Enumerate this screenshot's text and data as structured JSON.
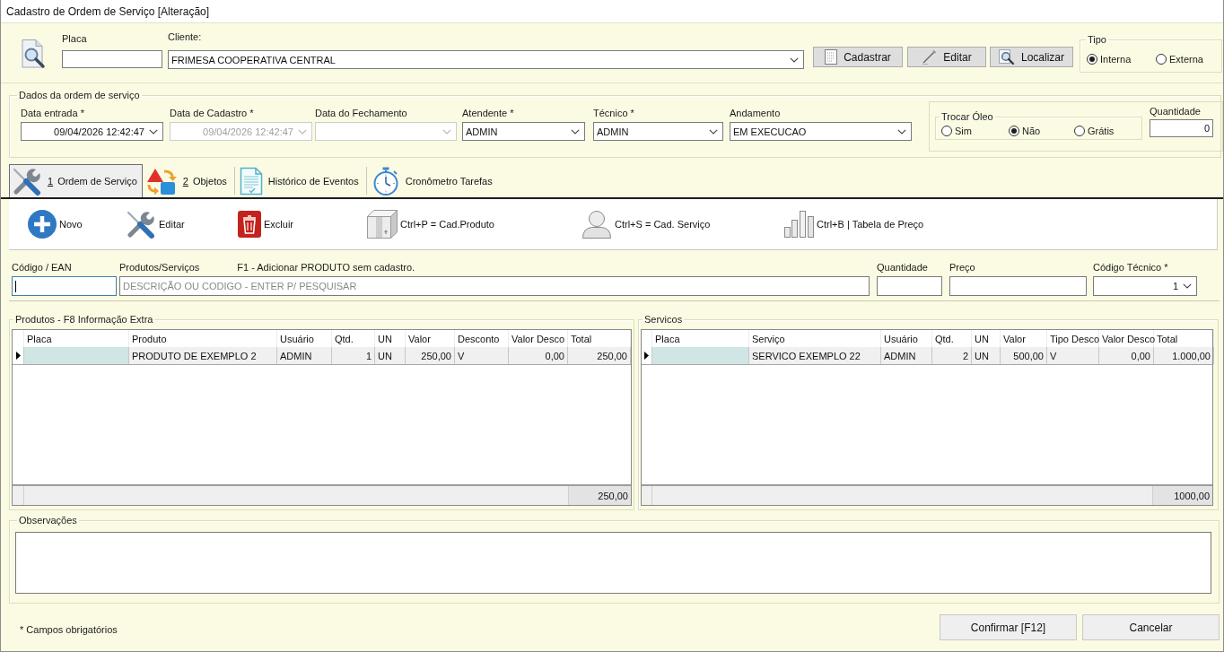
{
  "window": {
    "title": "Cadastro de Ordem de Serviço [Alteração]"
  },
  "header": {
    "placa": {
      "label": "Placa"
    },
    "cliente": {
      "label": "Cliente:",
      "value": "FRIMESA COOPERATIVA CENTRAL"
    },
    "buttons": [
      {
        "label": "Cadastrar",
        "kind": "document"
      },
      {
        "label": "Editar",
        "kind": "pencil"
      },
      {
        "label": "Localizar",
        "kind": "search"
      }
    ],
    "tipo": {
      "label": "Tipo",
      "options": [
        {
          "label": "Interna",
          "selected": true
        },
        {
          "label": "Externa",
          "selected": false
        }
      ]
    }
  },
  "dados": {
    "title": "Dados da ordem de serviço",
    "fields": [
      {
        "label": "Data entrada *",
        "kind": "date",
        "value": "09/04/2026 12:42:47",
        "disabled": false
      },
      {
        "label": "Data de Cadastro *",
        "kind": "date",
        "value": "09/04/2026 12:42:47",
        "disabled": true
      },
      {
        "label": "Data do Fechamento",
        "kind": "date",
        "disabled": true
      },
      {
        "label": "Atendente *",
        "kind": "select",
        "value": "ADMIN",
        "disabled": false
      },
      {
        "label": "Técnico *",
        "kind": "select",
        "value": "ADMIN",
        "disabled": false
      },
      {
        "label": "Andamento",
        "kind": "select",
        "value": "EM EXECUCAO",
        "disabled": false
      }
    ],
    "trocar_oleo": {
      "label": "Trocar Óleo",
      "options": [
        {
          "label": "Sim",
          "selected": false
        },
        {
          "label": "Não",
          "selected": true
        },
        {
          "label": "Grátis",
          "selected": false
        }
      ]
    },
    "quantidade": {
      "label": "Quantidade",
      "value": "0"
    }
  },
  "tabs": [
    {
      "hotkey": "1",
      "label": "Ordem de Serviço",
      "kind": "tools",
      "selected": true
    },
    {
      "hotkey": "2",
      "label": "Objetos",
      "kind": "shapes",
      "selected": false
    },
    {
      "label": "Histórico de Eventos",
      "kind": "document",
      "selected": false
    },
    {
      "label": "Cronômetro Tarefas",
      "kind": "stopwatch",
      "selected": false
    }
  ],
  "toolbar": [
    {
      "label": "Novo",
      "kind": "add"
    },
    {
      "label": "Editar",
      "kind": "tools"
    },
    {
      "label": "Excluir",
      "kind": "delete"
    },
    {
      "label": "Ctrl+P = Cad.Produto",
      "kind": "box"
    },
    {
      "label": "Ctrl+S = Cad. Serviço",
      "kind": "person"
    },
    {
      "label": "Ctrl+B | Tabela de Preço",
      "kind": "chart"
    }
  ],
  "item_entry": {
    "codigo": {
      "label": "Código / EAN",
      "focused": true
    },
    "produto": {
      "label": "Produtos/Serviços",
      "hint": "F1 - Adicionar PRODUTO sem cadastro.",
      "placeholder": "DESCRIÇÃO OU CODIGO - ENTER P/ PESQUISAR"
    },
    "quantidade": {
      "label": "Quantidade"
    },
    "preco": {
      "label": "Preço"
    },
    "codigo_tecnico": {
      "label": "Código Técnico *",
      "value": "1"
    }
  },
  "produtos": {
    "title": "Produtos - F8 Informação Extra",
    "columns": [
      {
        "label": "Placa",
        "kind": "text"
      },
      {
        "label": "Produto",
        "kind": "text"
      },
      {
        "label": "Usuário",
        "kind": "text"
      },
      {
        "label": "Qtd.",
        "kind": "number"
      },
      {
        "label": "UN",
        "kind": "text"
      },
      {
        "label": "Valor",
        "kind": "number"
      },
      {
        "label": "Desconto",
        "kind": "text"
      },
      {
        "label": "Valor Desco",
        "kind": "number"
      },
      {
        "label": "Total",
        "kind": "number"
      }
    ],
    "rows": [
      {
        "selected": true,
        "cells": [
          {
            "focused": true
          },
          {
            "text": "PRODUTO DE EXEMPLO 2",
            "focused": false
          },
          {
            "text": "ADMIN",
            "focused": false
          },
          {
            "text": "1",
            "focused": false
          },
          {
            "text": "UN",
            "focused": false
          },
          {
            "text": "250,00",
            "focused": false
          },
          {
            "text": "V",
            "focused": false
          },
          {
            "text": "0,00",
            "focused": false
          },
          {
            "text": "250,00",
            "focused": false
          }
        ]
      }
    ],
    "total": "250,00"
  },
  "servicos": {
    "title": "Servicos",
    "columns": [
      {
        "label": "Placa",
        "kind": "text"
      },
      {
        "label": "Serviço",
        "kind": "text"
      },
      {
        "label": "Usuário",
        "kind": "text"
      },
      {
        "label": "Qtd.",
        "kind": "number"
      },
      {
        "label": "UN",
        "kind": "text"
      },
      {
        "label": "Valor",
        "kind": "number"
      },
      {
        "label": "Tipo Desco",
        "kind": "text"
      },
      {
        "label": "Valor Desco",
        "kind": "number"
      },
      {
        "label": "Total",
        "kind": "number"
      }
    ],
    "rows": [
      {
        "selected": true,
        "cells": [
          {
            "focused": true
          },
          {
            "text": "SERVICO EXEMPLO 22",
            "focused": false
          },
          {
            "text": "ADMIN",
            "focused": false
          },
          {
            "text": "2",
            "focused": false
          },
          {
            "text": "UN",
            "focused": false
          },
          {
            "text": "500,00",
            "focused": false
          },
          {
            "text": "V",
            "focused": false
          },
          {
            "text": "0,00",
            "focused": false
          },
          {
            "text": "1.000,00",
            "focused": false
          }
        ]
      }
    ],
    "total": "1000,00"
  },
  "observacoes": {
    "label": "Observações"
  },
  "footer": {
    "note": "* Campos obrigatórios",
    "buttons": [
      {
        "label": "Confirmar [F12]"
      },
      {
        "label": "Cancelar"
      }
    ]
  }
}
